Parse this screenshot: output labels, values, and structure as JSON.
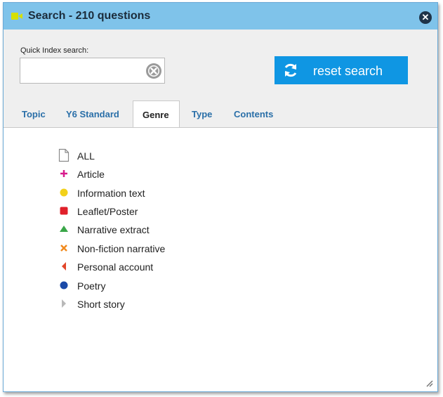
{
  "dialog": {
    "title": "Search - 210 questions",
    "close_symbol": "✕",
    "title_icon": "video-camera-icon"
  },
  "search": {
    "label": "Quick Index search:",
    "value": "",
    "placeholder": "",
    "reset_label": "reset search"
  },
  "tabs": [
    {
      "label": "Topic",
      "active": false
    },
    {
      "label": "Y6 Standard",
      "active": false
    },
    {
      "label": "Genre",
      "active": true
    },
    {
      "label": "Type",
      "active": false
    },
    {
      "label": "Contents",
      "active": false
    }
  ],
  "genres": [
    {
      "label": "ALL",
      "icon": "document-icon",
      "color": "#8a8a8a"
    },
    {
      "label": "Article",
      "icon": "plus-icon",
      "color": "#d81b8c"
    },
    {
      "label": "Information text",
      "icon": "circle-icon",
      "color": "#f2d11a"
    },
    {
      "label": "Leaflet/Poster",
      "icon": "square-icon",
      "color": "#e0202a"
    },
    {
      "label": "Narrative extract",
      "icon": "triangle-up-icon",
      "color": "#3aa648"
    },
    {
      "label": "Non-fiction narrative",
      "icon": "cross-icon",
      "color": "#f18a1e"
    },
    {
      "label": "Personal account",
      "icon": "triangle-left-icon",
      "color": "#e2472a"
    },
    {
      "label": "Poetry",
      "icon": "circle-icon",
      "color": "#1b4aa8"
    },
    {
      "label": "Short story",
      "icon": "triangle-right-icon",
      "color": "#b9b9b9"
    }
  ],
  "colors": {
    "titlebar": "#7fc3ea",
    "accent": "#0f96e3",
    "tab_text": "#2a6fa8"
  }
}
